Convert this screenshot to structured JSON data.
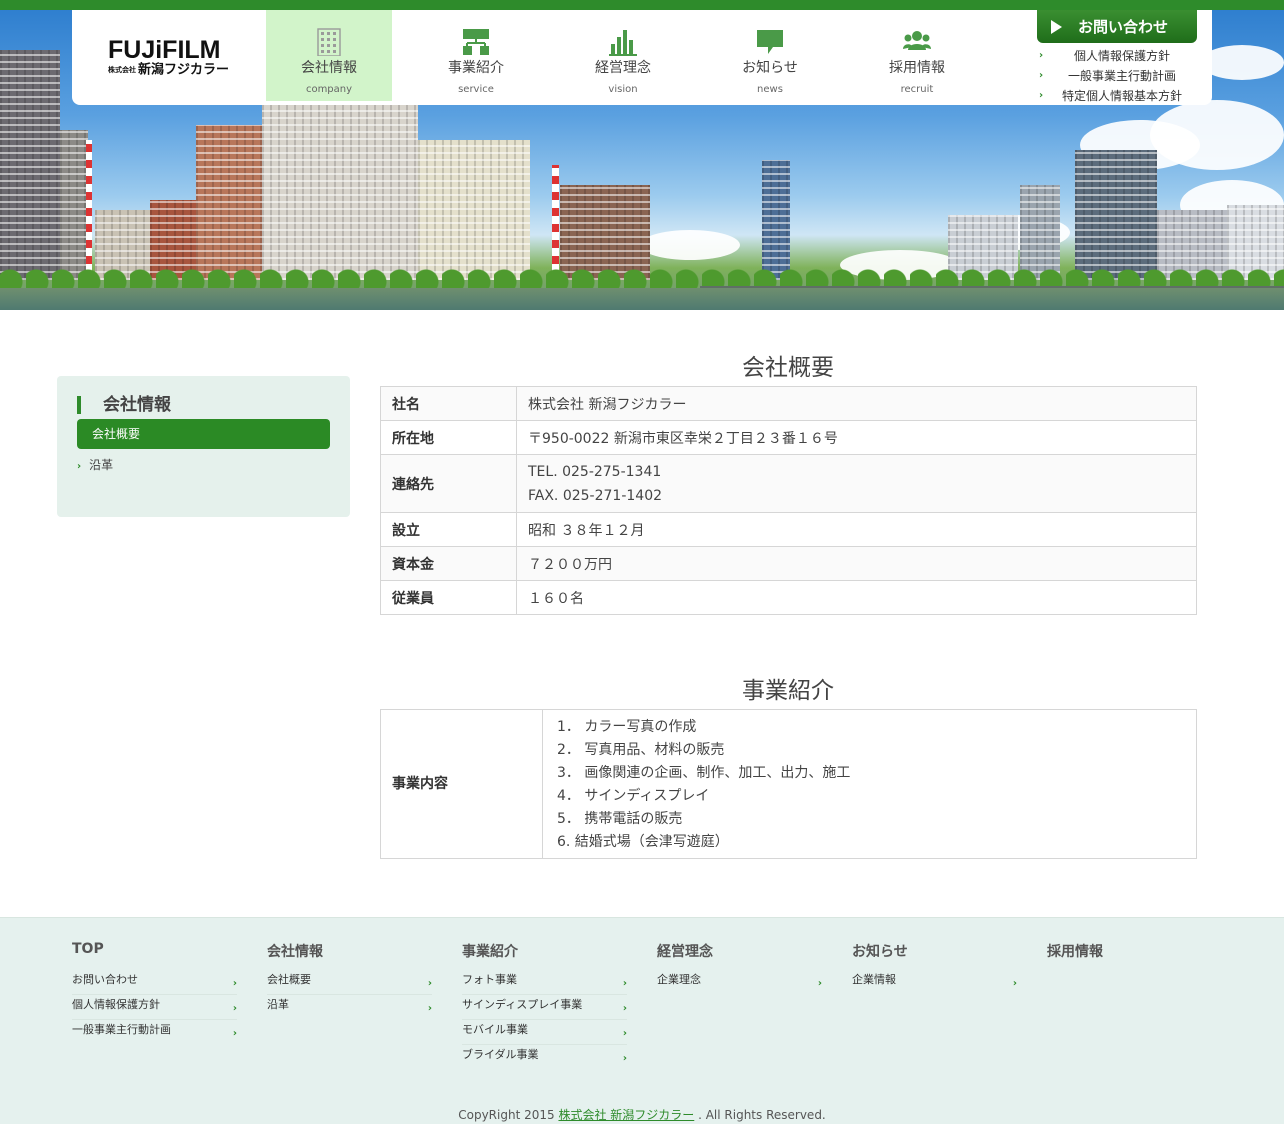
{
  "header": {
    "logo_main": "FUJiFILM",
    "logo_sub_small": "株式会社",
    "logo_sub": "新潟フジカラー",
    "nav": [
      {
        "jp": "会社情報",
        "en": "company",
        "icon": "building-icon"
      },
      {
        "jp": "事業紹介",
        "en": "service",
        "icon": "org-chart-icon"
      },
      {
        "jp": "経営理念",
        "en": "vision",
        "icon": "bar-chart-icon"
      },
      {
        "jp": "お知らせ",
        "en": "news",
        "icon": "speech-bubble-icon"
      },
      {
        "jp": "採用情報",
        "en": "recruit",
        "icon": "people-icon"
      }
    ],
    "contact": "お問い合わせ",
    "sublinks": [
      "個人情報保護方針",
      "一般事業主行動計画",
      "特定個人情報基本方針"
    ]
  },
  "side": {
    "title": "会社情報",
    "current": "会社概要",
    "item": "沿革"
  },
  "overview": {
    "title": "会社概要",
    "rows": [
      {
        "label": "社名",
        "value": "株式会社 新潟フジカラー"
      },
      {
        "label": "所在地",
        "value": "〒950-0022 新潟市東区幸栄２丁目２３番１６号"
      },
      {
        "label": "連絡先",
        "tel": "TEL. 025-275-1341",
        "fax": "FAX. 025-271-1402"
      },
      {
        "label": "設立",
        "value": "昭和 ３８年１２月"
      },
      {
        "label": "資本金",
        "value": "７２００万円"
      },
      {
        "label": "従業員",
        "value": "１６０名"
      }
    ]
  },
  "business": {
    "title": "事業紹介",
    "label": "事業内容",
    "items": [
      "1． カラー写真の作成",
      "2． 写真用品、材料の販売",
      "3． 画像関連の企画、制作、加工、出力、施工",
      "4． サインディスプレイ",
      "5． 携帯電話の販売",
      "6. 結婚式場（会津写遊庭）"
    ]
  },
  "footer": {
    "cols": [
      {
        "h": "TOP",
        "links": [
          "お問い合わせ",
          "個人情報保護方針",
          "一般事業主行動計画"
        ]
      },
      {
        "h": "会社情報",
        "links": [
          "会社概要",
          "沿革"
        ]
      },
      {
        "h": "事業紹介",
        "links": [
          "フォト事業",
          "サインディスプレイ事業",
          "モバイル事業",
          "ブライダル事業"
        ]
      },
      {
        "h": "経営理念",
        "links": [
          "企業理念"
        ]
      },
      {
        "h": "お知らせ",
        "links": [
          "企業情報"
        ]
      },
      {
        "h": "採用情報",
        "links": []
      }
    ],
    "copy_pre": "CopyRight 2015 ",
    "copy_link": "株式会社 新潟フジカラー",
    "copy_post": " . All Rights Reserved."
  },
  "colors": {
    "brand_green": "#2e8b2b",
    "active_nav": "#d2f4ca",
    "footer_bg": "#e5f1ee"
  }
}
